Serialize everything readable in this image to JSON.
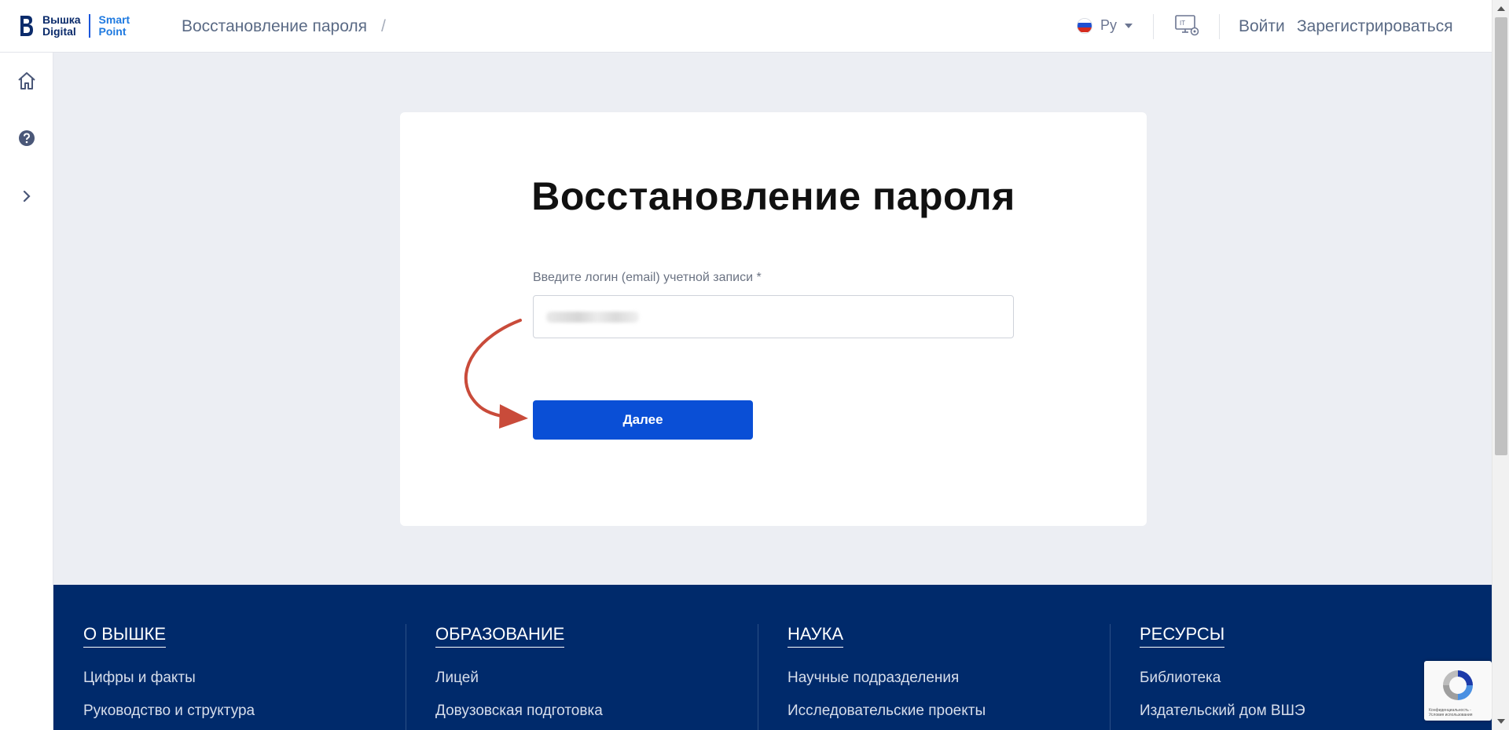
{
  "header": {
    "logo_line1": "Вышка",
    "logo_line2": "Digital",
    "logo_line3": "Smart",
    "logo_line4": "Point",
    "breadcrumb": "Восстановление пароля",
    "breadcrumb_sep": "/",
    "language": "Ру",
    "login": "Войти",
    "register": "Зарегистрироваться"
  },
  "sidebar": {
    "items": [
      {
        "name": "home-icon"
      },
      {
        "name": "help-icon"
      },
      {
        "name": "chevron-right-icon"
      }
    ]
  },
  "form": {
    "title": "Восстановление пароля",
    "email_label": "Введите логин (email) учетной записи *",
    "email_value": "",
    "next_button": "Далее"
  },
  "footer": {
    "columns": [
      {
        "heading": "О ВЫШКЕ",
        "links": [
          "Цифры и факты",
          "Руководство и структура"
        ]
      },
      {
        "heading": "ОБРАЗОВАНИЕ",
        "links": [
          "Лицей",
          "Довузовская подготовка"
        ]
      },
      {
        "heading": "НАУКА",
        "links": [
          "Научные подразделения",
          "Исследовательские проекты"
        ]
      },
      {
        "heading": "РЕСУРСЫ",
        "links": [
          "Библиотека",
          "Издательский дом ВШЭ"
        ]
      }
    ]
  },
  "recaptcha": {
    "text1": "Конфиденциальность -",
    "text2": "Условия использования"
  },
  "colors": {
    "primary_button": "#0a4fd6",
    "footer_bg": "#002a6b",
    "annotation_arrow": "#c94b3a"
  }
}
